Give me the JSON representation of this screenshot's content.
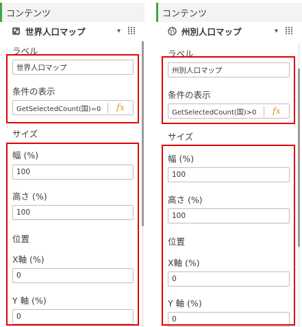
{
  "left_panel": {
    "header": "コンテンツ",
    "object_title": "世界人口マップ",
    "icon": "world-map-icon",
    "label_heading": "ラベル",
    "label_value": "世界人口マップ",
    "show_condition_heading": "条件の表示",
    "show_condition_value": "GetSelectedCount(国)=0",
    "size_heading": "サイズ",
    "width_label": "幅 (%)",
    "width_value": "100",
    "height_label": "高さ (%)",
    "height_value": "100",
    "position_heading": "位置",
    "x_label": "X軸 (%)",
    "x_value": "0",
    "y_label": "Y 軸 (%)",
    "y_value": "0"
  },
  "right_panel": {
    "header": "コンテンツ",
    "object_title": "州別人口マップ",
    "icon": "globe-icon",
    "label_heading": "ラベル",
    "label_value": "州別人口マップ",
    "show_condition_heading": "条件の表示",
    "show_condition_value": "GetSelectedCount(国)>0",
    "size_heading": "サイズ",
    "width_label": "幅 (%)",
    "width_value": "100",
    "height_label": "高さ (%)",
    "height_value": "100",
    "position_heading": "位置",
    "x_label": "X軸 (%)",
    "x_value": "0",
    "y_label": "Y 軸 (%)",
    "y_value": "0"
  },
  "fx_symbol": "fx",
  "colors": {
    "accent_green": "#3aa845",
    "highlight_red": "#e00000",
    "fx_orange": "#d59b2d"
  }
}
